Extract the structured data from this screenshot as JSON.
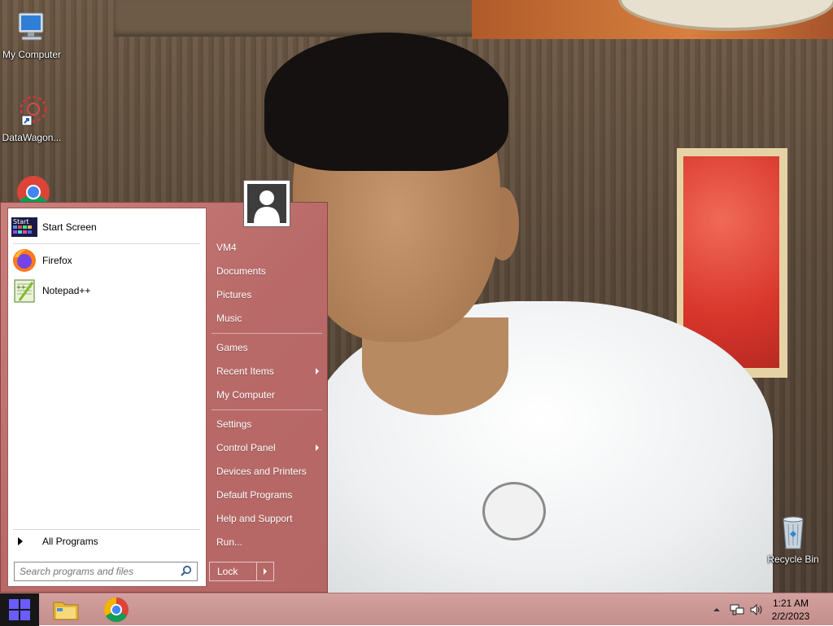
{
  "desktop": {
    "icons": [
      {
        "label": "My Computer",
        "icon": "my-computer-icon"
      },
      {
        "label": "DataWagon...",
        "icon": "datawagon-shortcut-icon"
      },
      {
        "label": "",
        "icon": "chrome-icon"
      },
      {
        "label": "Recycle Bin",
        "icon": "recycle-bin-icon"
      }
    ]
  },
  "start_menu": {
    "pinned": [
      {
        "label": "Start Screen",
        "icon": "start-screen-icon",
        "badge": "Start"
      },
      {
        "label": "Firefox",
        "icon": "firefox-icon"
      },
      {
        "label": "Notepad++",
        "icon": "notepadpp-icon"
      }
    ],
    "all_programs": "All Programs",
    "search_placeholder": "Search programs and files",
    "right_items": [
      {
        "label": "VM4"
      },
      {
        "label": "Documents"
      },
      {
        "label": "Pictures"
      },
      {
        "label": "Music"
      },
      {
        "label": "Games"
      },
      {
        "label": "Recent Items",
        "submenu": true
      },
      {
        "label": "My Computer"
      },
      {
        "label": "Settings"
      },
      {
        "label": "Control Panel",
        "submenu": true
      },
      {
        "label": "Devices and Printers"
      },
      {
        "label": "Default Programs"
      },
      {
        "label": "Help and Support"
      },
      {
        "label": "Run..."
      }
    ],
    "lock_label": "Lock"
  },
  "taskbar": {
    "apps": [
      {
        "name": "file-explorer",
        "icon": "folder-icon"
      },
      {
        "name": "chrome",
        "icon": "chrome-icon"
      }
    ],
    "time": "1:21 AM",
    "date": "2/2/2023"
  },
  "colors": {
    "start_menu": "#b96a68",
    "taskbar": "#c99694",
    "start_button": "#171717",
    "windows_logo": "#6a5cff"
  }
}
